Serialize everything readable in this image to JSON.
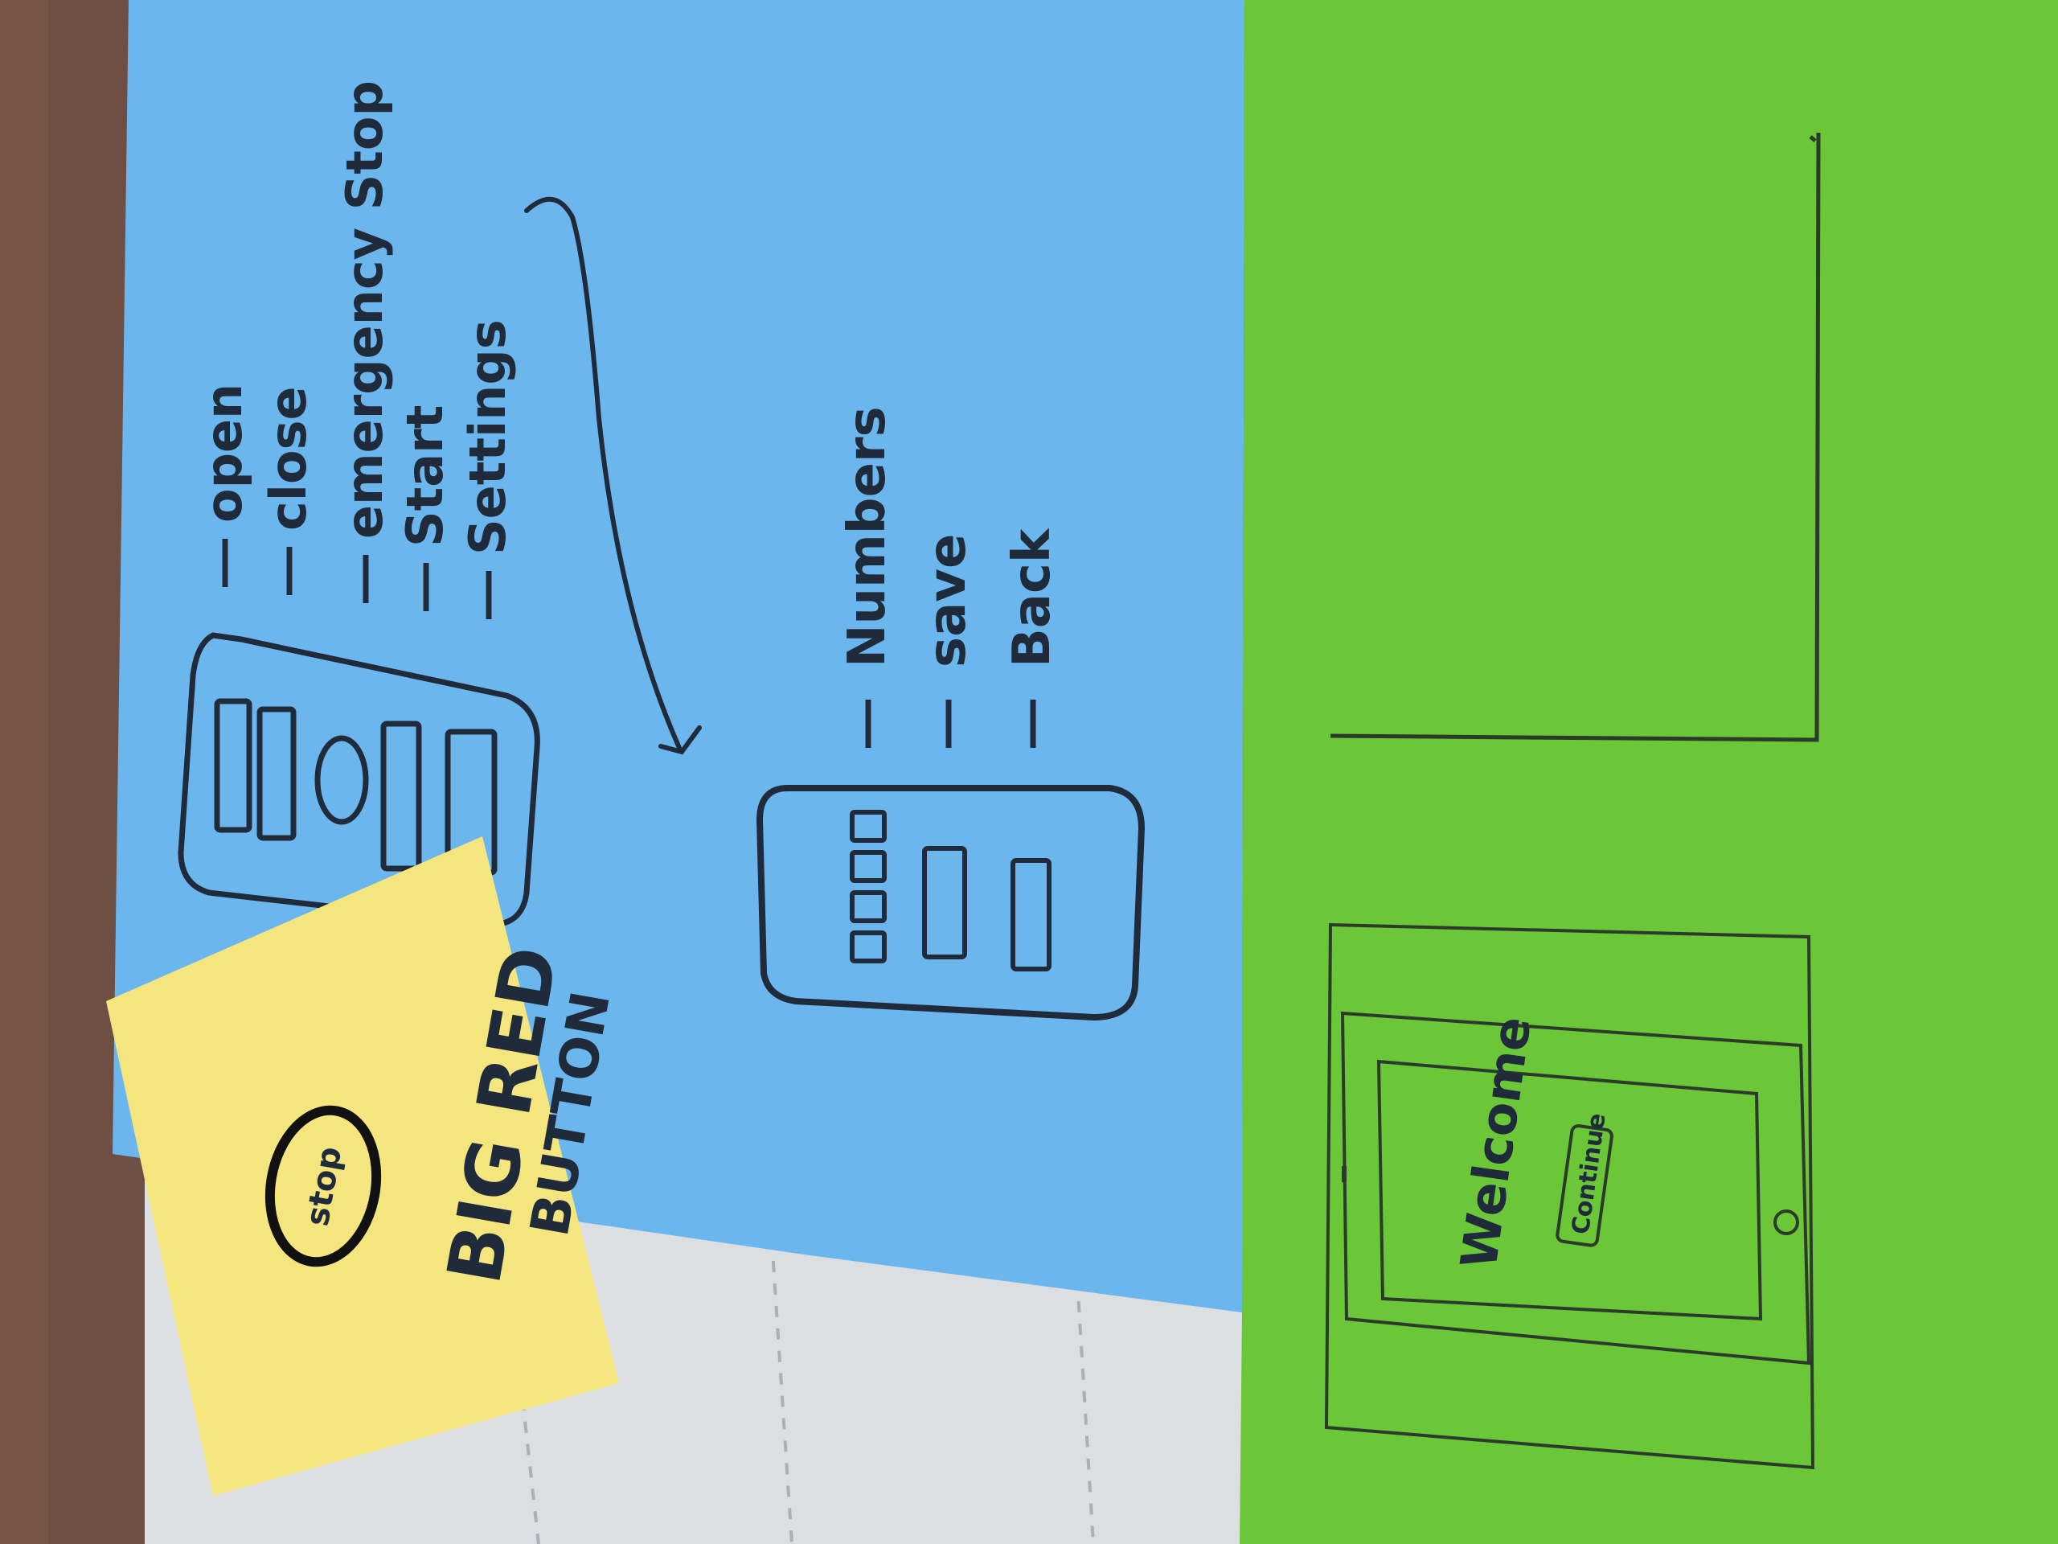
{
  "photo": {
    "subject": "paper-prototype-sketches",
    "colors": {
      "table": "#6f4f43",
      "paper_white": "#dcdfe2",
      "blue_sheet": "#6cb6ee",
      "green_sheet": "#6bc638",
      "sticky_note": "#f5e57e",
      "ink": "#1f2b3a"
    }
  },
  "blue_sheet": {
    "menu_items": [
      "open",
      "close",
      "emergency Stop",
      "Start",
      "Settings"
    ],
    "settings_items": [
      "Numbers",
      "save",
      "Back"
    ]
  },
  "sticky_note": {
    "button_label": "stop",
    "line1": "BIG RED",
    "line2": "BUTTON"
  },
  "green_sheet": {
    "welcome_text": "Welcome",
    "button_label": "Continue"
  }
}
